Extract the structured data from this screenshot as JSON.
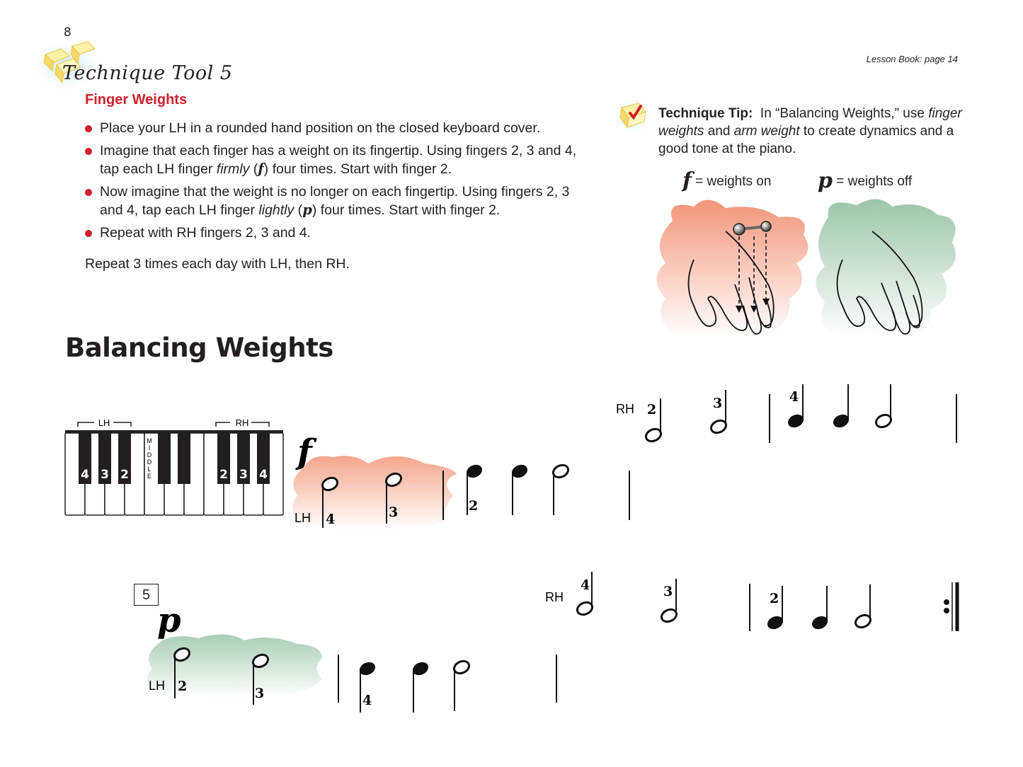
{
  "page_number": "8",
  "header": {
    "tool_title": "Technique Tool 5",
    "subtitle": "Finger Weights",
    "lesson_reference": "Lesson Book: page 14"
  },
  "instructions": {
    "bullets": [
      {
        "text": "Place your LH in a rounded hand position on the closed keyboard cover."
      },
      {
        "before": "Imagine that each finger has a weight on its fingertip.  Using fingers 2, 3 and 4, tap each LH finger ",
        "emph": "firmly",
        "dyn": "f",
        "after": " four times.  Start with finger 2."
      },
      {
        "before": "Now imagine that the weight is no longer on each fingertip.  Using fingers 2, 3 and 4, tap each LH finger ",
        "emph": "lightly",
        "dyn": "p",
        "after": " four times.  Start with finger 2."
      },
      {
        "text": "Repeat with RH fingers 2, 3 and 4."
      }
    ],
    "repeat_line": "Repeat 3 times each day with LH, then RH."
  },
  "technique_tip": {
    "label": "Technique Tip:",
    "text_1": "In “Balancing Weights,” use ",
    "emph_1": "finger weights",
    "text_2": " and ",
    "emph_2": "arm weight",
    "text_3": " to create dynamics and a good tone at the piano.",
    "legend_f_symbol": "f",
    "legend_f_text": " = weights on",
    "legend_p_symbol": "p",
    "legend_p_text": " = weights off"
  },
  "section_title": "Balancing Weights",
  "keyboard": {
    "lh_label": "LH",
    "rh_label": "RH",
    "middle_label": "MIDDLE",
    "lh_fingers": [
      "4",
      "3",
      "2"
    ],
    "rh_fingers": [
      "2",
      "3",
      "4"
    ]
  },
  "music": {
    "line1": {
      "dynamic": "f",
      "lh_label": "LH",
      "rh_label": "RH",
      "lh_fingerings": [
        "4",
        "3",
        "2"
      ],
      "rh_fingerings": [
        "2",
        "3",
        "4"
      ],
      "lh_notes": [
        "half",
        "half",
        "quarter",
        "quarter",
        "half"
      ],
      "rh_notes": [
        "half",
        "half",
        "quarter",
        "quarter",
        "half"
      ]
    },
    "line2": {
      "measure_number": "5",
      "dynamic": "p",
      "lh_label": "LH",
      "rh_label": "RH",
      "lh_fingerings": [
        "2",
        "3",
        "4"
      ],
      "rh_fingerings": [
        "4",
        "3",
        "2"
      ],
      "lh_notes": [
        "half",
        "half",
        "quarter",
        "quarter",
        "half"
      ],
      "rh_notes": [
        "half",
        "half",
        "quarter",
        "quarter",
        "half"
      ],
      "ending": "repeat-sign"
    }
  },
  "colors": {
    "accent_red": "#d0202a",
    "forte_cloud": "#f4a58a",
    "piano_cloud": "#a9cdb4",
    "icon_yellow": "#f9e57a"
  }
}
